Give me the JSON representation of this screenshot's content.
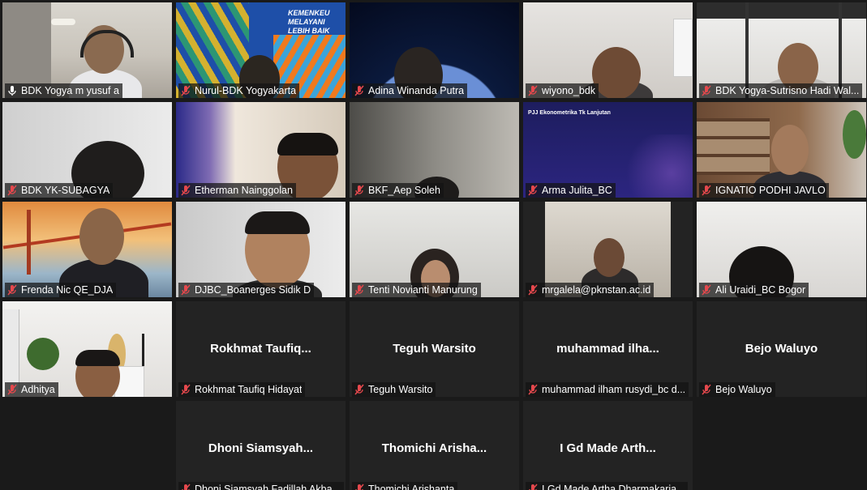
{
  "participants": [
    {
      "label": "BDK Yogya m yusuf a",
      "mic": "mic-icon",
      "active": true
    },
    {
      "label": "Nurul-BDK Yogyakarta",
      "mic": "mic-muted-icon",
      "slide_title": "KEMENKEU MELAYANI LEBIH BAIK"
    },
    {
      "label": "Adina Winanda Putra",
      "mic": "mic-muted-icon"
    },
    {
      "label": "wiyono_bdk",
      "mic": "mic-muted-icon"
    },
    {
      "label": "BDK Yogya-Sutrisno Hadi Wal...",
      "mic": "mic-muted-icon"
    },
    {
      "label": "BDK YK-SUBAGYA",
      "mic": "mic-muted-icon"
    },
    {
      "label": "Etherman Nainggolan",
      "mic": "mic-muted-icon"
    },
    {
      "label": "BKF_Aep Soleh",
      "mic": "mic-muted-icon"
    },
    {
      "label": "Arma Julita_BC",
      "mic": "mic-muted-icon",
      "slide_title": "PJJ Ekonometrika Tk Lanjutan"
    },
    {
      "label": "IGNATIO PODHI JAVLO",
      "mic": "mic-muted-icon"
    },
    {
      "label": "Frenda Nic QE_DJA",
      "mic": "mic-muted-icon"
    },
    {
      "label": "DJBC_Boanerges Sidik D",
      "mic": "mic-muted-icon"
    },
    {
      "label": "Tenti Novianti Manurung",
      "mic": "mic-muted-icon"
    },
    {
      "label": "mrgalela@pknstan.ac.id",
      "mic": "mic-muted-icon"
    },
    {
      "label": "Ali Uraidi_BC Bogor",
      "mic": "mic-muted-icon"
    },
    {
      "label": "Adhitya",
      "mic": "mic-muted-icon"
    },
    {
      "label": "Rokhmat Taufiq Hidayat",
      "mic": "mic-muted-icon",
      "center": "Rokhmat  Taufiq..."
    },
    {
      "label": "Teguh Warsito",
      "mic": "mic-muted-icon",
      "center": "Teguh Warsito"
    },
    {
      "label": "muhammad ilham rusydi_bc d...",
      "mic": "mic-muted-icon",
      "center": "muhammad  ilha..."
    },
    {
      "label": "Bejo Waluyo",
      "mic": "mic-muted-icon",
      "center": "Bejo Waluyo"
    },
    {
      "label": "Dhoni Siamsyah Fadillah Akba...",
      "mic": "mic-muted-icon",
      "center": "Dhoni  Siamsyah..."
    },
    {
      "label": "Thomichi Arishanta",
      "mic": "mic-muted-icon",
      "center": "Thomichi  Arisha..."
    },
    {
      "label": "I Gd Made Artha Dharmakaria...",
      "mic": "mic-muted-icon",
      "center": "I Gd Made Arth..."
    }
  ],
  "colors": {
    "active_border": "#c5e35b",
    "muted_mic": "#e5484d",
    "tile_bg": "#232323",
    "page_bg": "#1a1a1a"
  }
}
